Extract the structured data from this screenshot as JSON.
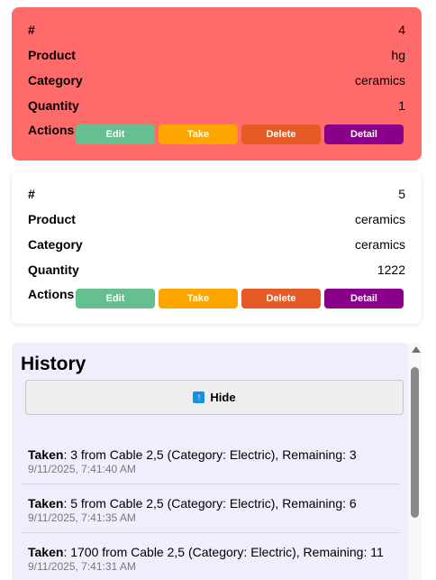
{
  "cards": [
    {
      "id_label": "#",
      "id_value": "4",
      "product_label": "Product",
      "product_value": "hg",
      "category_label": "Category",
      "category_value": "ceramics",
      "quantity_label": "Quantity",
      "quantity_value": "1",
      "actions_label": "Actions",
      "background": "#ff6b6b"
    },
    {
      "id_label": "#",
      "id_value": "5",
      "product_label": "Product",
      "product_value": "ceramics",
      "category_label": "Category",
      "category_value": "ceramics",
      "quantity_label": "Quantity",
      "quantity_value": "1222",
      "actions_label": "Actions",
      "background": "#ffffff"
    }
  ],
  "buttons": {
    "edit": "Edit",
    "take": "Take",
    "delete": "Delete",
    "detail": "Detail"
  },
  "button_colors": {
    "edit": "#66bf8f",
    "take": "#ffa500",
    "delete": "#e65a25",
    "detail": "#8b008b"
  },
  "history": {
    "title": "History",
    "hide_label": "Hide",
    "hide_icon": "up-arrow-icon",
    "entries": [
      {
        "action": "Taken",
        "text": ": 3 from Cable 2,5 (Category: Electric), Remaining: 3",
        "time": "9/11/2025, 7:41:40 AM"
      },
      {
        "action": "Taken",
        "text": ": 5 from Cable 2,5 (Category: Electric), Remaining: 6",
        "time": "9/11/2025, 7:41:35 AM"
      },
      {
        "action": "Taken",
        "text": ": 1700 from Cable 2,5 (Category: Electric), Remaining: 11",
        "time": "9/11/2025, 7:41:31 AM"
      }
    ]
  }
}
